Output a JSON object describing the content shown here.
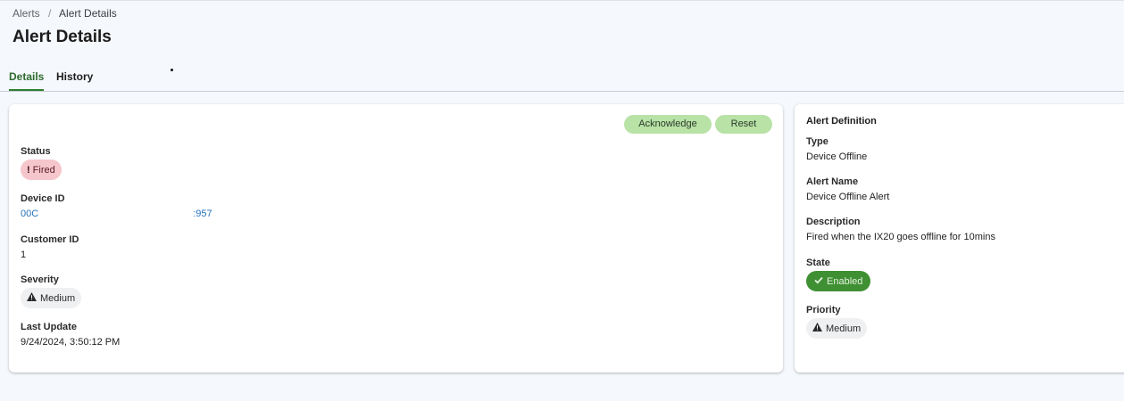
{
  "breadcrumb": {
    "parent": "Alerts",
    "separator": "/",
    "current": "Alert Details"
  },
  "page": {
    "title": "Alert Details"
  },
  "tabs": [
    {
      "label": "Details",
      "active": true
    },
    {
      "label": "History",
      "active": false
    }
  ],
  "actions": {
    "acknowledge_label": "Acknowledge",
    "reset_label": "Reset"
  },
  "details": {
    "status": {
      "label": "Status",
      "value": "Fired",
      "icon": "exclamation-icon"
    },
    "device_id": {
      "label": "Device ID",
      "value_start": "00C",
      "value_end": ":957"
    },
    "customer_id": {
      "label": "Customer ID",
      "value": "1"
    },
    "severity": {
      "label": "Severity",
      "value": "Medium",
      "icon": "warning-icon"
    },
    "last_update": {
      "label": "Last Update",
      "value": "9/24/2024, 3:50:12 PM"
    }
  },
  "definition": {
    "title": "Alert Definition",
    "type": {
      "label": "Type",
      "value": "Device Offline"
    },
    "alert_name": {
      "label": "Alert Name",
      "value": "Device Offline Alert"
    },
    "description": {
      "label": "Description",
      "value": "Fired when the IX20 goes offline for 10mins"
    },
    "state": {
      "label": "State",
      "value": "Enabled",
      "icon": "check-icon"
    },
    "priority": {
      "label": "Priority",
      "value": "Medium",
      "icon": "warning-icon"
    }
  },
  "colors": {
    "accent_green": "#2e7d32",
    "button_bg": "#b8e2a6",
    "fired_bg": "#f5c6cb",
    "enabled_bg": "#3f8f33",
    "link": "#2673b8"
  }
}
